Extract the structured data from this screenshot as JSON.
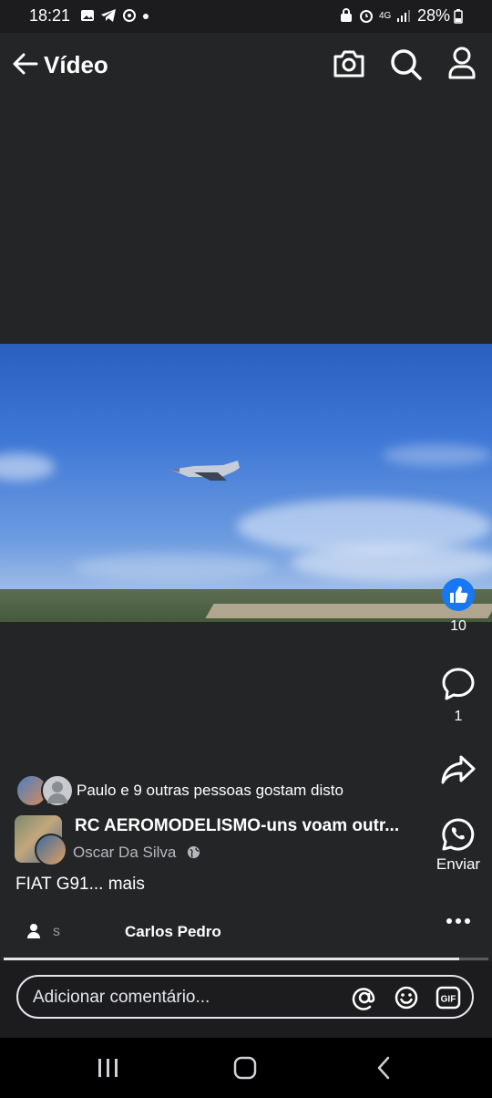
{
  "status": {
    "time": "18:21",
    "network": "4G",
    "battery": "28%"
  },
  "header": {
    "title": "Vídeo"
  },
  "video": {
    "description": "aircraft-in-flight"
  },
  "actions": {
    "like_count": "10",
    "comment_count": "1",
    "send_label": "Enviar"
  },
  "post": {
    "likes_text": "Paulo e 9 outras pessoas gostam disto",
    "page_name": "RC AEROMODELISMO-uns voam outr...",
    "author": "Oscar Da Silva",
    "caption": "FIAT G91... mais"
  },
  "tabs": {
    "left_label": "s",
    "right_label": "Carlos Pedro"
  },
  "progress": {
    "fraction": 0.94
  },
  "comment": {
    "placeholder": "Adicionar comentário..."
  },
  "colors": {
    "background": "#242526",
    "like_blue": "#1877f2",
    "text": "#ffffff"
  }
}
